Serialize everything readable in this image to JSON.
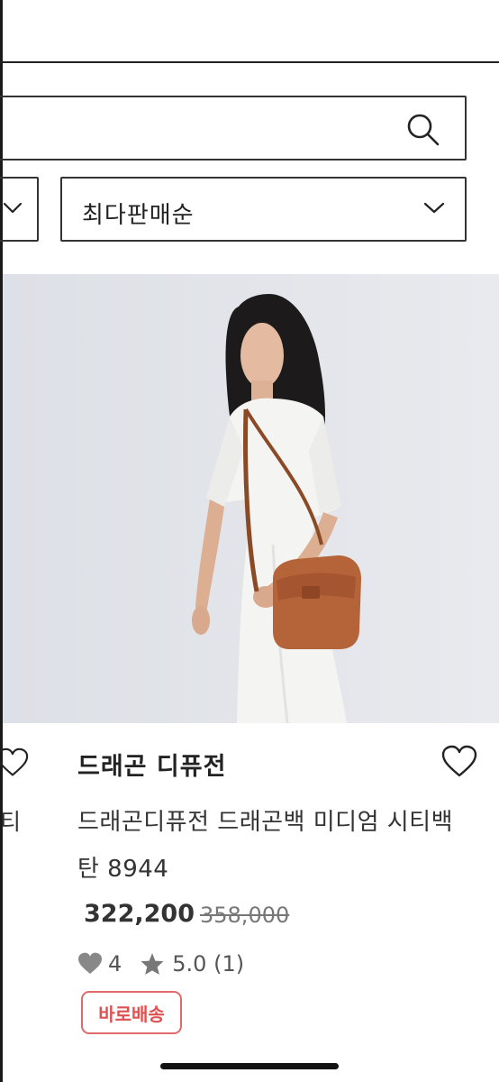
{
  "search": {
    "placeholder": ""
  },
  "sort": {
    "selected": "최다판매순"
  },
  "product": {
    "brand": "드래곤 디퓨전",
    "title": "드래곤디퓨전 드래곤백 미디엄 시티백 탄 8944",
    "price": "322,200",
    "original_price": "358,000",
    "likes": "4",
    "rating": "5.0 (1)",
    "badge": "바로배송",
    "image_alt": "드래곤디퓨전 드래곤백 미디엄 시티백 탄"
  },
  "adjacent_card": {
    "title_fragment": "티"
  },
  "icons": {
    "search": "search-icon",
    "dropdown": "chevron-down-icon",
    "wishlist": "heart-outline-icon",
    "likes": "heart-filled-icon",
    "rating": "star-icon"
  },
  "colors": {
    "badge": "#e05050",
    "text": "#222222",
    "muted": "#777777",
    "image_bg": "#e3e5ea",
    "bag": "#b5643a"
  }
}
